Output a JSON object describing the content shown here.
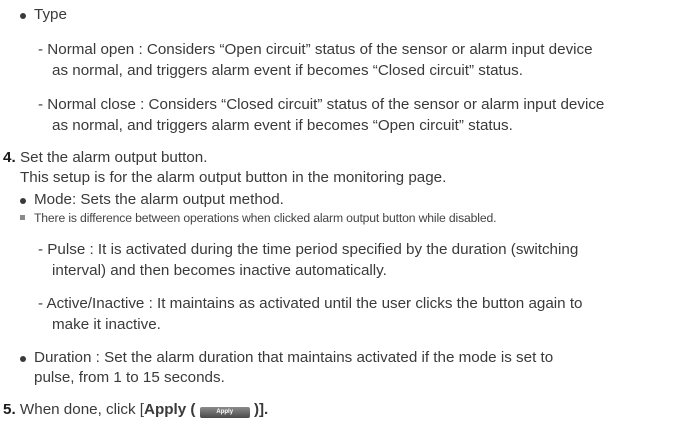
{
  "type_section": {
    "label": "Type",
    "normal_open_1": "- Normal open : Considers “Open circuit” status of the sensor or alarm input device",
    "normal_open_2": "as normal, and triggers alarm event if becomes “Closed circuit” status.",
    "normal_close_1": "- Normal close : Considers “Closed circuit” status of the sensor or alarm input device",
    "normal_close_2": "as normal, and triggers alarm event if becomes “Open circuit” status."
  },
  "step4": {
    "number": "4.",
    "title": "Set the alarm output button.",
    "desc": "This setup is for the alarm output button in the monitoring page.",
    "mode": "Mode: Sets the alarm output method.",
    "note": "There is difference between operations when clicked alarm output button while disabled.",
    "pulse_1": "- Pulse : It is activated during the time period specified by the duration (switching",
    "pulse_2": "interval) and then becomes inactive automatically.",
    "active_1": "- Active/Inactive : It maintains as activated until the user clicks the button again to",
    "active_2": "make it inactive.",
    "duration_1": "Duration : Set the alarm duration that maintains activated if the mode is set to",
    "duration_2": "pulse, from 1 to 15 seconds."
  },
  "step5": {
    "number": "5.",
    "prefix": "When done, click [",
    "apply_bold": "Apply (",
    "apply_button": "Apply",
    "suffix": ")]."
  }
}
